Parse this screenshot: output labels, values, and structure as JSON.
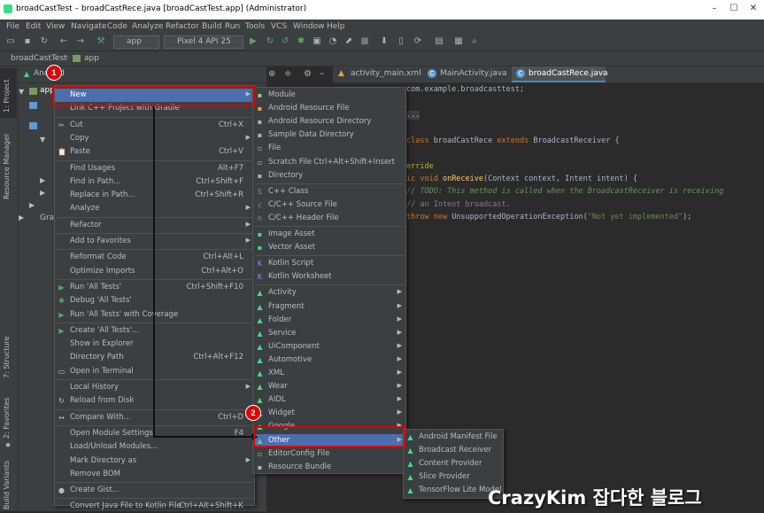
{
  "window": {
    "title": "broadCastTest – broadCastRece.java [broadCastTest.app] (Administrator)"
  },
  "menubar": [
    "File",
    "Edit",
    "View",
    "Navigate",
    "Code",
    "Analyze",
    "Refactor",
    "Build",
    "Run",
    "Tools",
    "VCS",
    "Window",
    "Help"
  ],
  "toolbar": {
    "module": "app",
    "device": "Pixel 4 API 25"
  },
  "navbar": {
    "project": "broadCastTest",
    "module": "app"
  },
  "leftstrip": {
    "project": "1: Project",
    "resource_manager": "Resource Manager",
    "structure": "7: Structure",
    "favorites": "2: Favorites",
    "build_variants": "Build Variants"
  },
  "project_panel": {
    "view_selector": "Android",
    "rows": [
      "app",
      "Gradle Scripts"
    ]
  },
  "tabs": [
    {
      "label": "activity_main.xml",
      "active": false
    },
    {
      "label": "MainActivity.java",
      "active": false
    },
    {
      "label": "broadCastRece.java",
      "active": true
    }
  ],
  "code": {
    "line1_kw": "",
    "line1": "com.example.broadcasttest;",
    "line2": "...",
    "line3_kw": "class",
    "line3_name": "broadCastRece",
    "line3_kw2": "extends",
    "line3_base": "BroadcastReceiver {",
    "line4": "erride",
    "line5_kw": "ic void",
    "line5_fn": "onReceive",
    "line5_rest": "(Context context, Intent intent) {",
    "line6": "// TODO: This method is called when the BroadcastReceiver is receiving",
    "line7": "// an Intent broadcast.",
    "line8_kw": "throw new",
    "line8_rest": "UnsupportedOperationException(",
    "line8_str": "\"Not yet implemented\"",
    "line8_end": ");"
  },
  "context_menu": [
    {
      "label": "New",
      "shortcut": "",
      "submenu": true,
      "selected": true
    },
    {
      "label": "Link C++ Project with Gradle",
      "shortcut": ""
    },
    {
      "sep": true
    },
    {
      "label": "Cut",
      "shortcut": "Ctrl+X",
      "icon": "✂"
    },
    {
      "label": "Copy",
      "shortcut": "",
      "submenu": true
    },
    {
      "label": "Paste",
      "shortcut": "Ctrl+V",
      "icon": "📋"
    },
    {
      "sep": true
    },
    {
      "label": "Find Usages",
      "shortcut": "Alt+F7"
    },
    {
      "label": "Find in Path...",
      "shortcut": "Ctrl+Shift+F"
    },
    {
      "label": "Replace in Path...",
      "shortcut": "Ctrl+Shift+R"
    },
    {
      "label": "Analyze",
      "shortcut": "",
      "submenu": true
    },
    {
      "sep": true
    },
    {
      "label": "Refactor",
      "shortcut": "",
      "submenu": true
    },
    {
      "sep": true
    },
    {
      "label": "Add to Favorites",
      "shortcut": "",
      "submenu": true
    },
    {
      "sep": true
    },
    {
      "label": "Reformat Code",
      "shortcut": "Ctrl+Alt+L"
    },
    {
      "label": "Optimize Imports",
      "shortcut": "Ctrl+Alt+O"
    },
    {
      "sep": true
    },
    {
      "label": "Run 'All Tests'",
      "shortcut": "Ctrl+Shift+F10",
      "icon": "▶",
      "iconColor": "#59a869"
    },
    {
      "label": "Debug 'All Tests'",
      "shortcut": "",
      "icon": "✱",
      "iconColor": "#59a869"
    },
    {
      "label": "Run 'All Tests' with Coverage",
      "shortcut": "",
      "icon": "▶",
      "iconColor": "#59a869"
    },
    {
      "sep": true
    },
    {
      "label": "Create 'All Tests'...",
      "shortcut": "",
      "icon": "▶",
      "iconColor": "#59a869"
    },
    {
      "label": "Show in Explorer",
      "shortcut": ""
    },
    {
      "label": "Directory Path",
      "shortcut": "Ctrl+Alt+F12"
    },
    {
      "label": "Open in Terminal",
      "shortcut": "",
      "icon": "▭"
    },
    {
      "sep": true
    },
    {
      "label": "Local History",
      "shortcut": "",
      "submenu": true
    },
    {
      "label": "Reload from Disk",
      "shortcut": "",
      "icon": "↻"
    },
    {
      "sep": true
    },
    {
      "label": "Compare With...",
      "shortcut": "Ctrl+D",
      "icon": "↔"
    },
    {
      "sep": true
    },
    {
      "label": "Open Module Settings",
      "shortcut": "F4"
    },
    {
      "label": "Load/Unload Modules...",
      "shortcut": ""
    },
    {
      "label": "Mark Directory as",
      "shortcut": "",
      "submenu": true
    },
    {
      "label": "Remove BOM",
      "shortcut": ""
    },
    {
      "sep": true
    },
    {
      "label": "Create Gist...",
      "shortcut": "",
      "icon": "●"
    },
    {
      "sep": true
    },
    {
      "label": "Convert Java File to Kotlin File",
      "shortcut": "Ctrl+Alt+Shift+K"
    }
  ],
  "new_menu": [
    {
      "label": "Module",
      "icon": "▪",
      "iconColor": "#afb1b3"
    },
    {
      "label": "Android Resource File",
      "icon": "▪",
      "iconColor": "#e8a33d"
    },
    {
      "label": "Android Resource Directory",
      "icon": "▪",
      "iconColor": "#afb1b3"
    },
    {
      "label": "Sample Data Directory",
      "icon": "▪",
      "iconColor": "#afb1b3"
    },
    {
      "label": "File",
      "icon": "▫",
      "iconColor": "#afb1b3"
    },
    {
      "label": "Scratch File",
      "shortcut": "Ctrl+Alt+Shift+Insert",
      "icon": "▫",
      "iconColor": "#afb1b3"
    },
    {
      "label": "Directory",
      "icon": "▪",
      "iconColor": "#afb1b3"
    },
    {
      "sep": true
    },
    {
      "label": "C++ Class",
      "icon": "S",
      "iconColor": "#5c9bd6"
    },
    {
      "label": "C/C++ Source File",
      "icon": "c",
      "iconColor": "#5c9bd6"
    },
    {
      "label": "C/C++ Header File",
      "icon": "h",
      "iconColor": "#5c9bd6"
    },
    {
      "sep": true
    },
    {
      "label": "Image Asset",
      "icon": "▪",
      "iconColor": "#3ddc84"
    },
    {
      "label": "Vector Asset",
      "icon": "▪",
      "iconColor": "#3ddc84"
    },
    {
      "sep": true
    },
    {
      "label": "Kotlin Script",
      "icon": "K",
      "iconColor": "#a97bff"
    },
    {
      "label": "Kotlin Worksheet",
      "icon": "K",
      "iconColor": "#a97bff"
    },
    {
      "sep": true
    },
    {
      "label": "Activity",
      "submenu": true,
      "icon": "▲",
      "iconColor": "#3ddc84"
    },
    {
      "label": "Fragment",
      "submenu": true,
      "icon": "▲",
      "iconColor": "#3ddc84"
    },
    {
      "label": "Folder",
      "submenu": true,
      "icon": "▲",
      "iconColor": "#3ddc84"
    },
    {
      "label": "Service",
      "submenu": true,
      "icon": "▲",
      "iconColor": "#3ddc84"
    },
    {
      "label": "UiComponent",
      "submenu": true,
      "icon": "▲",
      "iconColor": "#3ddc84"
    },
    {
      "label": "Automotive",
      "submenu": true,
      "icon": "▲",
      "iconColor": "#3ddc84"
    },
    {
      "label": "XML",
      "submenu": true,
      "icon": "▲",
      "iconColor": "#3ddc84"
    },
    {
      "label": "Wear",
      "submenu": true,
      "icon": "▲",
      "iconColor": "#3ddc84"
    },
    {
      "label": "AIDL",
      "submenu": true,
      "icon": "▲",
      "iconColor": "#3ddc84"
    },
    {
      "label": "Widget",
      "submenu": true,
      "icon": "▲",
      "iconColor": "#3ddc84"
    },
    {
      "label": "Google",
      "submenu": true,
      "icon": "▲",
      "iconColor": "#3ddc84"
    },
    {
      "label": "Other",
      "submenu": true,
      "selected": true,
      "icon": "▲",
      "iconColor": "#3ddc84"
    },
    {
      "label": "EditorConfig File",
      "icon": "▫",
      "iconColor": "#afb1b3"
    },
    {
      "label": "Resource Bundle",
      "icon": "▪",
      "iconColor": "#afb1b3"
    }
  ],
  "other_menu": [
    {
      "label": "Android Manifest File",
      "icon": "▲",
      "iconColor": "#3ddc84"
    },
    {
      "label": "Broadcast Receiver",
      "icon": "▲",
      "iconColor": "#3ddc84"
    },
    {
      "label": "Content Provider",
      "icon": "▲",
      "iconColor": "#3ddc84"
    },
    {
      "label": "Slice Provider",
      "icon": "▲",
      "iconColor": "#3ddc84"
    },
    {
      "label": "TensorFlow Lite Model",
      "icon": "▲",
      "iconColor": "#3ddc84"
    }
  ],
  "annotations": {
    "badge1": "1",
    "badge2": "2"
  },
  "watermark": "CrazyKim 잡다한 블로그"
}
